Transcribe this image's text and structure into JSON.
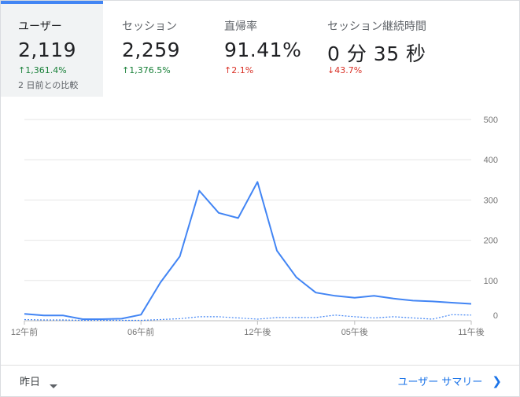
{
  "metrics": [
    {
      "label": "ユーザー",
      "value": "2,119",
      "change": "1,361.4%",
      "direction": "up",
      "compare": "2 日前との比較"
    },
    {
      "label": "セッション",
      "value": "2,259",
      "change": "1,376.5%",
      "direction": "up"
    },
    {
      "label": "直帰率",
      "value": "91.41%",
      "change": "2.1%",
      "direction": "up_red"
    },
    {
      "label": "セッション継続時間",
      "value": "0 分 35 秒",
      "change": "43.7%",
      "direction": "down"
    }
  ],
  "footer": {
    "date_range": "昨日",
    "summary_link": "ユーザー サマリー"
  },
  "colors": {
    "accent": "#4285f4",
    "line": "#4285f4",
    "up": "#188038",
    "down": "#d93025"
  },
  "icons": {
    "up": "arrow-up-icon",
    "down": "arrow-down-icon",
    "dropdown": "caret-down-icon",
    "next": "chevron-right-icon"
  },
  "chart_data": {
    "type": "line",
    "x_tick_labels": [
      "12午前",
      "06午前",
      "12午後",
      "05午後",
      "11午後"
    ],
    "x_tick_index": [
      0,
      6,
      12,
      17,
      23
    ],
    "y_ticks": [
      0,
      100,
      200,
      300,
      400,
      500
    ],
    "ylim": [
      0,
      500
    ],
    "grid": true,
    "series": [
      {
        "style": "solid",
        "values": [
          17,
          13,
          13,
          4,
          4,
          5,
          15,
          95,
          160,
          323,
          268,
          255,
          345,
          174,
          108,
          70,
          62,
          57,
          62,
          55,
          50,
          48,
          45,
          42
        ]
      },
      {
        "style": "dashed",
        "values": [
          3,
          2,
          2,
          1,
          1,
          1,
          1,
          3,
          5,
          10,
          10,
          7,
          4,
          8,
          8,
          8,
          14,
          10,
          7,
          10,
          7,
          4,
          15,
          14
        ]
      }
    ]
  }
}
